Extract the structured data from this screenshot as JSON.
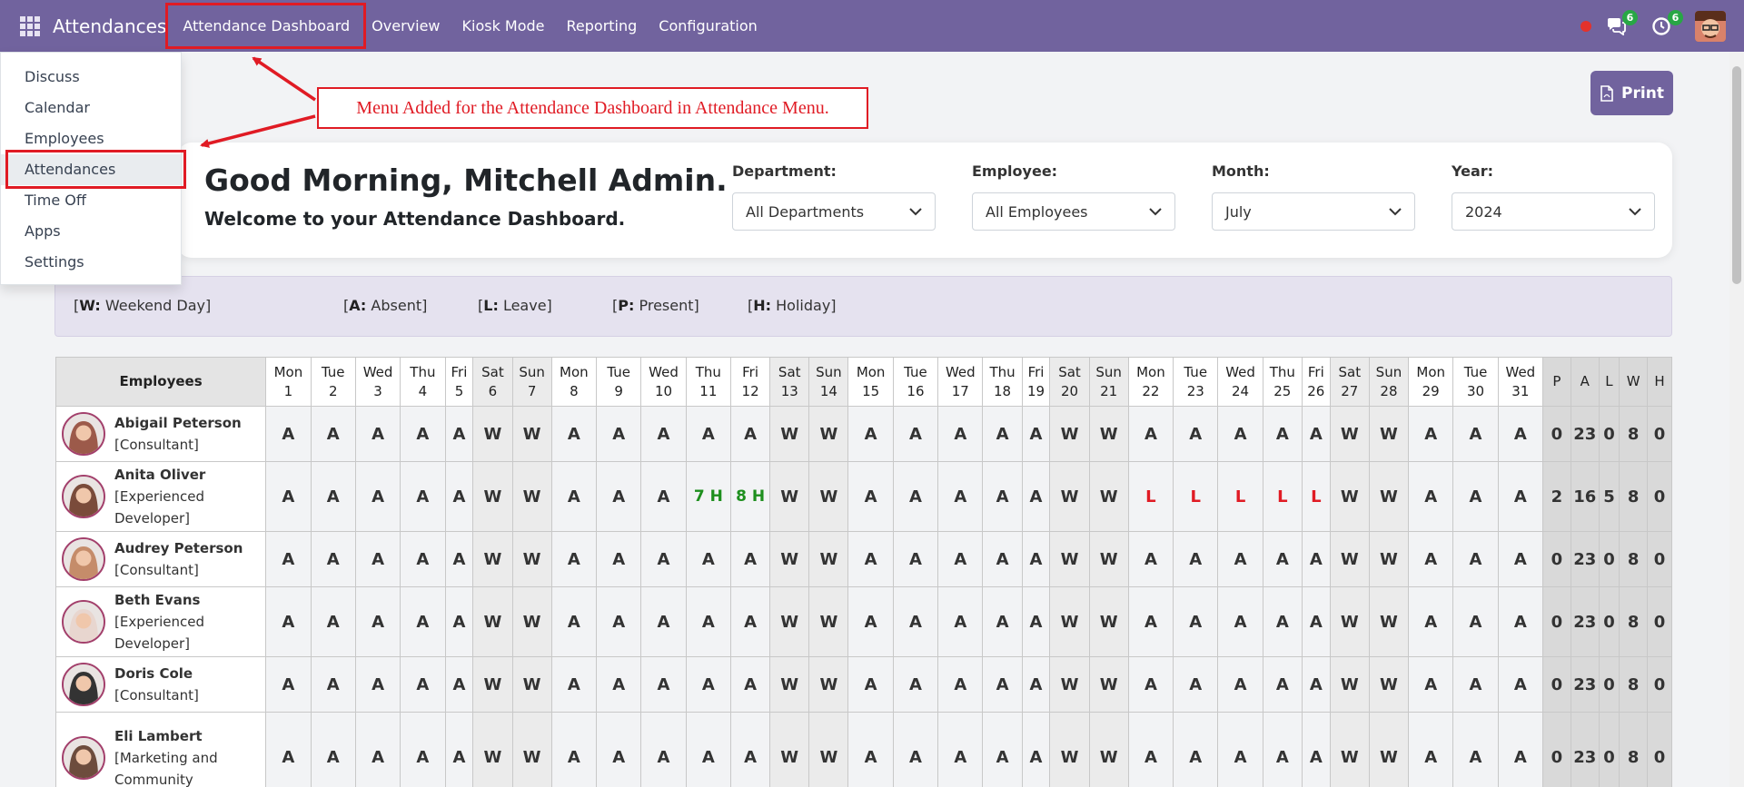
{
  "navbar": {
    "app_title": "Attendances",
    "menus": [
      "Attendance Dashboard",
      "Overview",
      "Kiosk Mode",
      "Reporting",
      "Configuration"
    ],
    "messages_badge": "6",
    "activities_badge": "6"
  },
  "apps_menu": [
    "Discuss",
    "Calendar",
    "Employees",
    "Attendances",
    "Time Off",
    "Apps",
    "Settings"
  ],
  "annotation": "Menu Added for the Attendance Dashboard in Attendance Menu.",
  "print_label": "Print",
  "greeting": {
    "title": "Good Morning, Mitchell Admin.",
    "subtitle": "Welcome to your Attendance Dashboard."
  },
  "filters": [
    {
      "label": "Department:",
      "value": "All Departments"
    },
    {
      "label": "Employee:",
      "value": "All Employees"
    },
    {
      "label": "Month:",
      "value": "July"
    },
    {
      "label": "Year:",
      "value": "2024"
    }
  ],
  "legend": [
    {
      "code": "W:",
      "text": "Weekend Day"
    },
    {
      "code": "A:",
      "text": "Absent"
    },
    {
      "code": "L:",
      "text": "Leave"
    },
    {
      "code": "P:",
      "text": "Present"
    },
    {
      "code": "H:",
      "text": "Holiday"
    }
  ],
  "table": {
    "employees_header": "Employees",
    "days": [
      {
        "dow": "Mon",
        "d": "1"
      },
      {
        "dow": "Tue",
        "d": "2"
      },
      {
        "dow": "Wed",
        "d": "3"
      },
      {
        "dow": "Thu",
        "d": "4"
      },
      {
        "dow": "Fri",
        "d": "5"
      },
      {
        "dow": "Sat",
        "d": "6"
      },
      {
        "dow": "Sun",
        "d": "7"
      },
      {
        "dow": "Mon",
        "d": "8"
      },
      {
        "dow": "Tue",
        "d": "9"
      },
      {
        "dow": "Wed",
        "d": "10"
      },
      {
        "dow": "Thu",
        "d": "11"
      },
      {
        "dow": "Fri",
        "d": "12"
      },
      {
        "dow": "Sat",
        "d": "13"
      },
      {
        "dow": "Sun",
        "d": "14"
      },
      {
        "dow": "Mon",
        "d": "15"
      },
      {
        "dow": "Tue",
        "d": "16"
      },
      {
        "dow": "Wed",
        "d": "17"
      },
      {
        "dow": "Thu",
        "d": "18"
      },
      {
        "dow": "Fri",
        "d": "19"
      },
      {
        "dow": "Sat",
        "d": "20"
      },
      {
        "dow": "Sun",
        "d": "21"
      },
      {
        "dow": "Mon",
        "d": "22"
      },
      {
        "dow": "Tue",
        "d": "23"
      },
      {
        "dow": "Wed",
        "d": "24"
      },
      {
        "dow": "Thu",
        "d": "25"
      },
      {
        "dow": "Fri",
        "d": "26"
      },
      {
        "dow": "Sat",
        "d": "27"
      },
      {
        "dow": "Sun",
        "d": "28"
      },
      {
        "dow": "Mon",
        "d": "29"
      },
      {
        "dow": "Tue",
        "d": "30"
      },
      {
        "dow": "Wed",
        "d": "31"
      }
    ],
    "totals_headers": [
      "P",
      "A",
      "L",
      "W",
      "H"
    ],
    "rows": [
      {
        "name": "Abigail Peterson",
        "position": "[Consultant]",
        "cells": [
          "A",
          "A",
          "A",
          "A",
          "A",
          "W",
          "W",
          "A",
          "A",
          "A",
          "A",
          "A",
          "W",
          "W",
          "A",
          "A",
          "A",
          "A",
          "A",
          "W",
          "W",
          "A",
          "A",
          "A",
          "A",
          "A",
          "W",
          "W",
          "A",
          "A",
          "A"
        ],
        "totals": [
          "0",
          "23",
          "0",
          "8",
          "0"
        ]
      },
      {
        "name": "Anita Oliver",
        "position": "[Experienced Developer]",
        "cells": [
          "A",
          "A",
          "A",
          "A",
          "A",
          "W",
          "W",
          "A",
          "A",
          "A",
          "7 H",
          "8 H",
          "W",
          "W",
          "A",
          "A",
          "A",
          "A",
          "A",
          "W",
          "W",
          "L",
          "L",
          "L",
          "L",
          "L",
          "W",
          "W",
          "A",
          "A",
          "A"
        ],
        "totals": [
          "2",
          "16",
          "5",
          "8",
          "0"
        ]
      },
      {
        "name": "Audrey Peterson",
        "position": "[Consultant]",
        "cells": [
          "A",
          "A",
          "A",
          "A",
          "A",
          "W",
          "W",
          "A",
          "A",
          "A",
          "A",
          "A",
          "W",
          "W",
          "A",
          "A",
          "A",
          "A",
          "A",
          "W",
          "W",
          "A",
          "A",
          "A",
          "A",
          "A",
          "W",
          "W",
          "A",
          "A",
          "A"
        ],
        "totals": [
          "0",
          "23",
          "0",
          "8",
          "0"
        ]
      },
      {
        "name": "Beth Evans",
        "position": "[Experienced Developer]",
        "cells": [
          "A",
          "A",
          "A",
          "A",
          "A",
          "W",
          "W",
          "A",
          "A",
          "A",
          "A",
          "A",
          "W",
          "W",
          "A",
          "A",
          "A",
          "A",
          "A",
          "W",
          "W",
          "A",
          "A",
          "A",
          "A",
          "A",
          "W",
          "W",
          "A",
          "A",
          "A"
        ],
        "totals": [
          "0",
          "23",
          "0",
          "8",
          "0"
        ]
      },
      {
        "name": "Doris Cole",
        "position": "[Consultant]",
        "cells": [
          "A",
          "A",
          "A",
          "A",
          "A",
          "W",
          "W",
          "A",
          "A",
          "A",
          "A",
          "A",
          "W",
          "W",
          "A",
          "A",
          "A",
          "A",
          "A",
          "W",
          "W",
          "A",
          "A",
          "A",
          "A",
          "A",
          "W",
          "W",
          "A",
          "A",
          "A"
        ],
        "totals": [
          "0",
          "23",
          "0",
          "8",
          "0"
        ]
      },
      {
        "name": "Eli Lambert",
        "position": "[Marketing and Community",
        "cells": [
          "A",
          "A",
          "A",
          "A",
          "A",
          "W",
          "W",
          "A",
          "A",
          "A",
          "A",
          "A",
          "W",
          "W",
          "A",
          "A",
          "A",
          "A",
          "A",
          "W",
          "W",
          "A",
          "A",
          "A",
          "A",
          "A",
          "W",
          "W",
          "A",
          "A",
          "A"
        ],
        "totals": [
          "0",
          "23",
          "0",
          "8",
          "0"
        ]
      }
    ]
  },
  "colors": {
    "navbar": "#71639e",
    "annotation_red": "#e01b24",
    "present_green": "#1e8f1e",
    "leave_red": "#e01b24"
  }
}
